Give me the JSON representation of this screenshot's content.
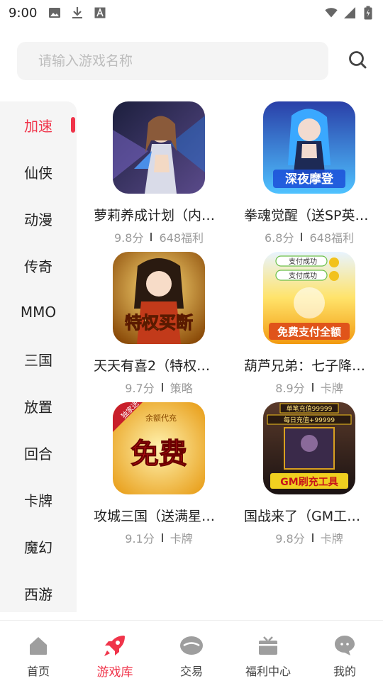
{
  "status_bar": {
    "time": "9:00",
    "icons_left": [
      "image-icon",
      "download-icon",
      "font-icon"
    ],
    "icons_right": [
      "wifi-icon",
      "signal-icon",
      "battery-icon"
    ]
  },
  "search": {
    "placeholder": "请输入游戏名称",
    "value": ""
  },
  "sidebar": {
    "items": [
      {
        "label": "加速",
        "active": true
      },
      {
        "label": "仙侠",
        "active": false
      },
      {
        "label": "动漫",
        "active": false
      },
      {
        "label": "传奇",
        "active": false
      },
      {
        "label": "MMO",
        "active": false
      },
      {
        "label": "三国",
        "active": false
      },
      {
        "label": "放置",
        "active": false
      },
      {
        "label": "回合",
        "active": false
      },
      {
        "label": "卡牌",
        "active": false
      },
      {
        "label": "魔幻",
        "active": false
      },
      {
        "label": "西游",
        "active": false
      }
    ]
  },
  "games": [
    {
      "name": "萝莉养成计划（内…",
      "score": "9.8分",
      "tag": "648福利",
      "cover_color": "#3a3f6e"
    },
    {
      "name": "拳魂觉醒（送SP英…",
      "score": "6.8分",
      "tag": "648福利",
      "cover_color": "#2c6fd6",
      "cover_text": "深夜摩登"
    },
    {
      "name": "天天有喜2（特权…",
      "score": "9.7分",
      "tag": "策略",
      "cover_color": "#c97a12",
      "cover_text": "特权买断"
    },
    {
      "name": "葫芦兄弟：七子降…",
      "score": "8.9分",
      "tag": "卡牌",
      "cover_color": "#f2b81c",
      "cover_text": "免费支付全额",
      "cover_badges": [
        "支付成功",
        "支付成功"
      ]
    },
    {
      "name": "攻城三国（送满星…",
      "score": "9.1分",
      "tag": "卡牌",
      "cover_color": "#f0a818",
      "cover_text": "免费",
      "cover_badges": [
        "独家送卡",
        "余额代充"
      ]
    },
    {
      "name": "国战来了（GM工…",
      "score": "9.8分",
      "tag": "卡牌",
      "cover_color": "#3a2a2a",
      "cover_text": "GM刷充工具",
      "cover_badges": [
        "单笔充值99999",
        "每日充值+99999"
      ]
    }
  ],
  "bottom_nav": {
    "items": [
      {
        "label": "首页",
        "icon": "home-icon",
        "active": false
      },
      {
        "label": "游戏库",
        "icon": "rocket-icon",
        "active": true
      },
      {
        "label": "交易",
        "icon": "trade-icon",
        "active": false
      },
      {
        "label": "福利中心",
        "icon": "gift-icon",
        "active": false
      },
      {
        "label": "我的",
        "icon": "chat-bubble-icon",
        "active": false
      }
    ]
  },
  "colors": {
    "accent": "#f0344a",
    "sidebar_bg": "#f5f5f5",
    "search_bg": "#f4f4f4",
    "icon_gray": "#9e9e9e"
  }
}
